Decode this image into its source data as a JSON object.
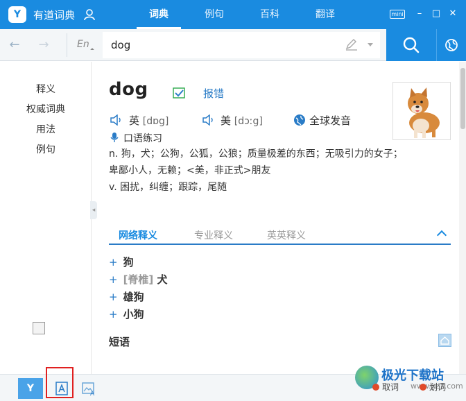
{
  "app": {
    "title": "有道词典",
    "logo_text": "Y",
    "mini_label": "mini",
    "minimize_glyph": "–",
    "maximize_glyph": "□",
    "close_glyph": "✕"
  },
  "nav": {
    "tabs": [
      {
        "label": "词典",
        "active": true
      },
      {
        "label": "例句",
        "active": false
      },
      {
        "label": "百科",
        "active": false
      },
      {
        "label": "翻译",
        "active": false
      }
    ]
  },
  "toolbar": {
    "back_glyph": "←",
    "forward_glyph": "→",
    "lang_label": "En",
    "search_value": "dog",
    "icons": [
      "back-arrow-icon",
      "forward-arrow-icon",
      "pen-icon",
      "search-icon",
      "globe-icon"
    ]
  },
  "sidebar": {
    "items": [
      {
        "label": "释义"
      },
      {
        "label": "权威词典"
      },
      {
        "label": "用法"
      },
      {
        "label": "例句"
      }
    ],
    "collapse_glyph": "◂"
  },
  "entry": {
    "word": "dog",
    "report_label": "报错",
    "uk_label": "英",
    "uk_phonetic": "[dɒg]",
    "us_label": "美",
    "us_phonetic": "[dɔːg]",
    "global_pron_label": "全球发音",
    "oral_practice_label": "口语练习",
    "definitions": [
      "n. 狗，犬；公狗，公狐，公狼；质量极差的东西；无吸引力的女子；",
      "卑鄙小人，无赖；<美，非正式>朋友",
      "v. 困扰，纠缠；跟踪，尾随"
    ]
  },
  "def_tabs": [
    {
      "label": "网络释义",
      "active": true
    },
    {
      "label": "专业释义",
      "active": false
    },
    {
      "label": "英英释义",
      "active": false
    }
  ],
  "net_defs": [
    {
      "tag": "",
      "text": "狗"
    },
    {
      "tag": "[脊椎]",
      "text": "犬"
    },
    {
      "tag": "",
      "text": "雄狗"
    },
    {
      "tag": "",
      "text": "小狗"
    }
  ],
  "plus_glyph": "+",
  "phrase_title": "短语",
  "colors": {
    "brand": "#1a8be0",
    "link": "#2a7cc7",
    "highlight_box": "#e02020"
  },
  "bottom": {
    "logo_text": "Y",
    "watermark_text": "极光下载站",
    "watermark_url": "www.xz7.com",
    "quci_label": "取词",
    "huaci_label": "划词"
  }
}
